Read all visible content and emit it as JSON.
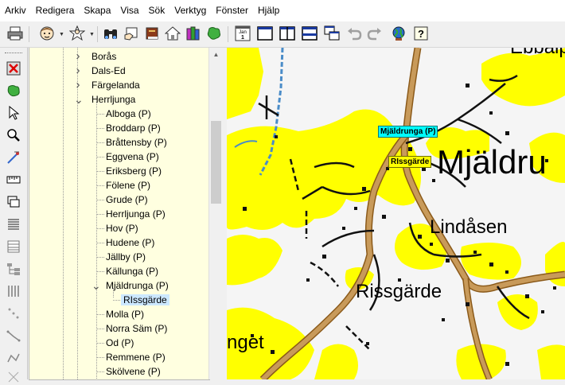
{
  "menu": [
    "Arkiv",
    "Redigera",
    "Skapa",
    "Visa",
    "Sök",
    "Verktyg",
    "Fönster",
    "Hjälp"
  ],
  "toolbar": {
    "calendar_text": "Jan\n1",
    "calendar_month": "Jan",
    "calendar_day": "1",
    "help_glyph": "?",
    "icons": [
      "print-icon",
      "person-icon",
      "person-star-icon",
      "binoculars-icon",
      "hand-book-icon",
      "book-icon",
      "house-icon",
      "books-icon",
      "map-icon",
      "calendar-icon",
      "window-single-icon",
      "window-split-vertical-icon",
      "window-split-horizontal-icon",
      "window-cascade-icon",
      "undo-icon",
      "redo-icon",
      "globe-icon",
      "help-icon"
    ]
  },
  "tree": {
    "items": [
      {
        "label": "Borås",
        "type": "parish"
      },
      {
        "label": "Dals-Ed",
        "type": "parish"
      },
      {
        "label": "Färgelanda",
        "type": "parish"
      },
      {
        "label": "Herrljunga",
        "type": "parish"
      },
      {
        "label": "Alboga (P)"
      },
      {
        "label": "Broddarp (P)"
      },
      {
        "label": "Bråttensby (P)"
      },
      {
        "label": "Eggvena (P)"
      },
      {
        "label": "Eriksberg (P)"
      },
      {
        "label": "Fölene (P)"
      },
      {
        "label": "Grude (P)"
      },
      {
        "label": "Herrljunga (P)"
      },
      {
        "label": "Hov (P)"
      },
      {
        "label": "Hudene (P)"
      },
      {
        "label": "Jällby (P)"
      },
      {
        "label": "Källunga (P)"
      },
      {
        "label": "Mjäldrunga (P)"
      },
      {
        "label": "RIssgärde"
      },
      {
        "label": "Molla (P)"
      },
      {
        "label": "Norra Säm (P)"
      },
      {
        "label": "Od (P)"
      },
      {
        "label": "Remmene (P)"
      },
      {
        "label": "Skölvene (P)"
      }
    ]
  },
  "map": {
    "place_labels": [
      "Mjäldru",
      "Lindåsen",
      "Rissgärde",
      "nget",
      "Ebbalp"
    ],
    "badges": {
      "parish": "Mjäldrunga (P)",
      "place": "RIssgärde"
    },
    "colors": {
      "built_area": "#ffff00",
      "road": "#c89a5a",
      "water": "#4a8cc8",
      "background": "#f5f5f5",
      "badge_parish": "#00ffff",
      "badge_place": "#ffff00"
    }
  }
}
